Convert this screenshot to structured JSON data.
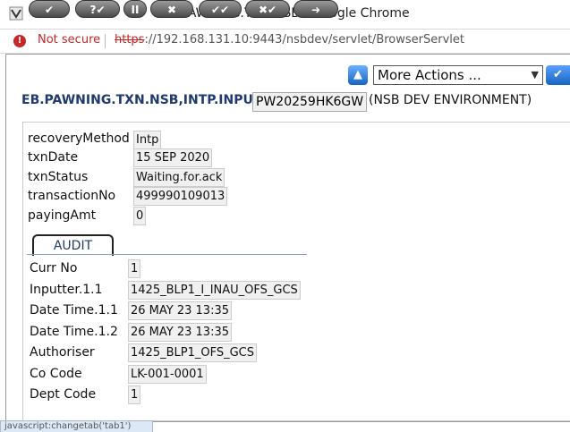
{
  "window": {
    "title": "EB.PAWNING.TXN.NSB - Google Chrome"
  },
  "address": {
    "security_label": "Not secure",
    "scheme": "https",
    "rest": "://192.168.131.10:9443/nsbdev/servlet/BrowserServlet"
  },
  "toolbar": {
    "buttons": [
      "✔",
      "?✔",
      "II",
      "✖",
      "✔✔",
      "✖✔",
      "➜"
    ],
    "actions_selected": "More Actions ..."
  },
  "app": {
    "version_name": "EB.PAWNING.TXN.NSB,INTP.INPUT",
    "txn_id": "PW20259HK6GW",
    "environment": "(NSB DEV ENVIRONMENT)"
  },
  "fields": [
    {
      "label": "recoveryMethod",
      "value": "Intp"
    },
    {
      "label": "txnDate",
      "value": "15 SEP 2020"
    },
    {
      "label": "txnStatus",
      "value": "Waiting.for.ack"
    },
    {
      "label": "transactionNo",
      "value": "499990109013"
    },
    {
      "label": "payingAmt",
      "value": "0"
    }
  ],
  "audit": {
    "tab_label": "AUDIT",
    "fields": [
      {
        "label": "Curr No",
        "value": "1"
      },
      {
        "label": "Inputter.1.1",
        "value": "1425_BLP1_I_INAU_OFS_GCS"
      },
      {
        "label": "Date Time.1.1",
        "value": "26 MAY 23 13:35"
      },
      {
        "label": "Date Time.1.2",
        "value": "26 MAY 23 13:35"
      },
      {
        "label": "Authoriser",
        "value": "1425_BLP1_OFS_GCS"
      },
      {
        "label": "Co Code",
        "value": "LK-001-0001"
      },
      {
        "label": "Dept Code",
        "value": "1"
      }
    ]
  },
  "status": {
    "text": "javascript:changetab('tab1')"
  },
  "colors": {
    "accent": "#1f3a6e",
    "warning": "#c62828"
  }
}
